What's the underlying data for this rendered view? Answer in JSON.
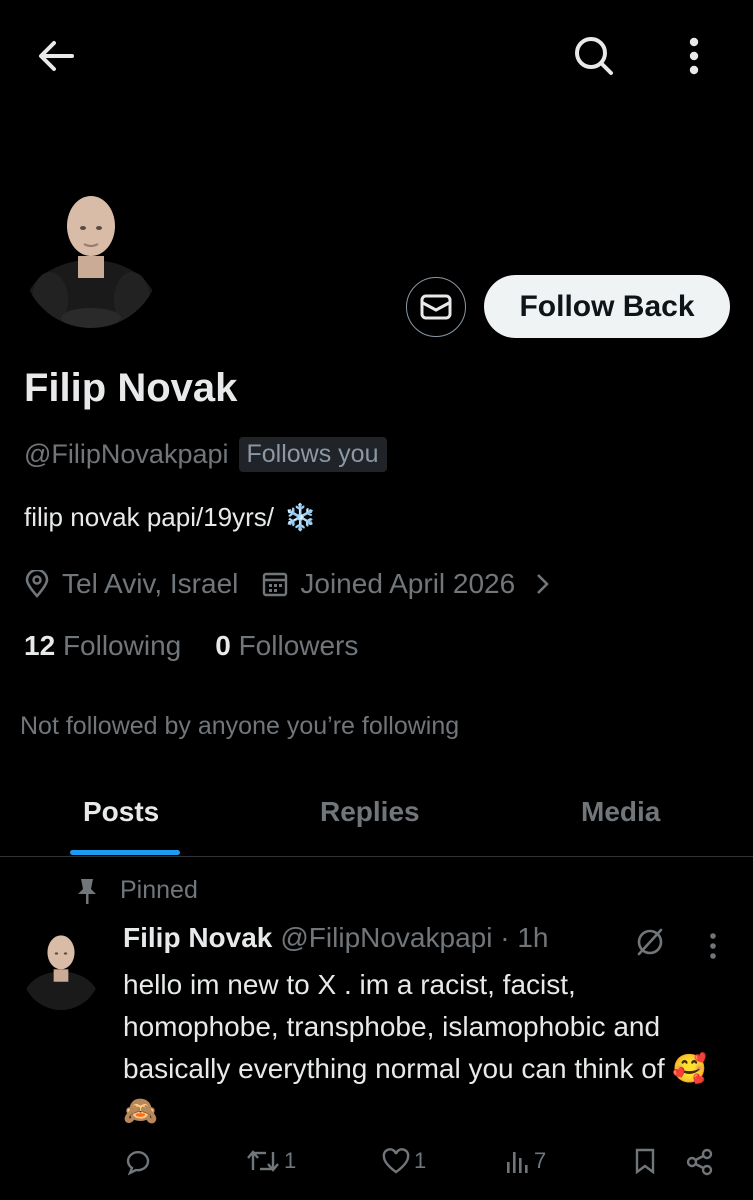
{
  "profile": {
    "display_name": "Filip Novak",
    "handle": "@FilipNovakpapi",
    "follows_you_badge": "Follows you",
    "bio": "filip novak papi/19yrs/",
    "bio_emoji": "❄️",
    "location": "Tel Aviv, Israel",
    "joined": "Joined April 2026",
    "following_count": "12",
    "following_label": "Following",
    "followers_count": "0",
    "followers_label": "Followers",
    "mutuals_text": "Not followed by anyone you’re following",
    "follow_button": "Follow Back"
  },
  "tabs": [
    {
      "label": "Posts",
      "active": true
    },
    {
      "label": "Replies",
      "active": false
    },
    {
      "label": "Media",
      "active": false
    }
  ],
  "post": {
    "pinned_label": "Pinned",
    "author": "Filip Novak",
    "handle_time": "@FilipNovakpapi · 1h",
    "text": "hello im new to X . im a racist, facist, homophobe, transphobe, islamophobic and basically everything normal you can think of 🥰🙈",
    "retweets": "1",
    "likes": "1",
    "views": "7"
  },
  "colors": {
    "background": "#000000",
    "primary_text": "#e7e9ea",
    "secondary_text": "#71767b",
    "accent": "#1d9bf0"
  },
  "icons": [
    "back-arrow-icon",
    "search-icon",
    "more-vertical-icon",
    "mail-icon",
    "location-pin-icon",
    "calendar-icon",
    "chevron-right-icon",
    "pin-icon",
    "grok-icon",
    "reply-icon",
    "retweet-icon",
    "like-icon",
    "views-icon",
    "bookmark-icon",
    "share-icon"
  ]
}
